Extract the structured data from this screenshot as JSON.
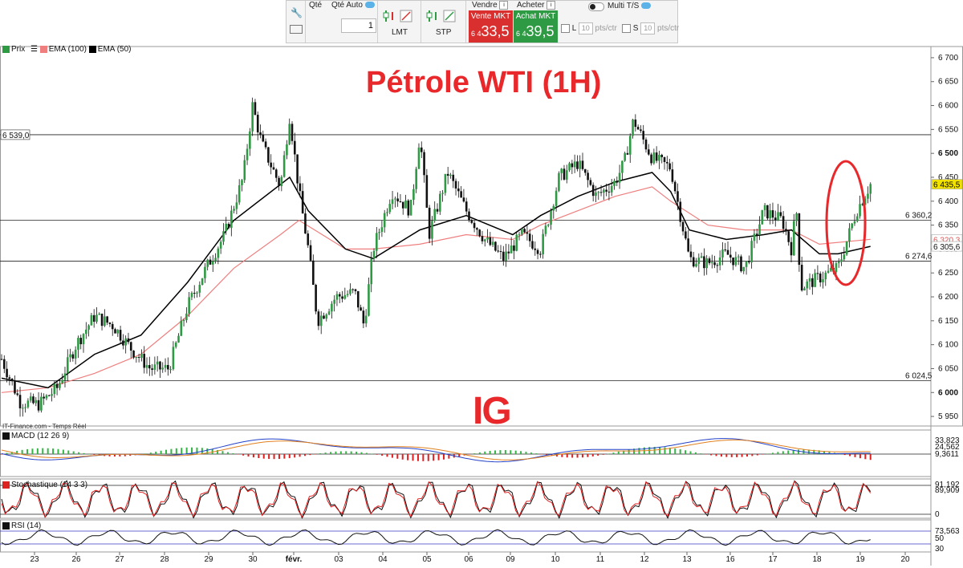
{
  "toolbar": {
    "qty_label": "Qté",
    "qty_auto_label": "Qté Auto",
    "qty_value": "1",
    "lmt_label": "LMT",
    "stp_label": "STP",
    "sell_header": "Vendre",
    "buy_header": "Acheter",
    "sell_button": "Vente MKT",
    "buy_button": "Achat MKT",
    "sell_price_prefix": "6 4",
    "sell_price_big": "33,5",
    "buy_price_prefix": "6 4",
    "buy_price_big": "39,5",
    "multi_label": "Multi T/S",
    "l_label": "L",
    "s_label": "S",
    "l_value": "10",
    "s_value": "10",
    "unit": "pts/ctr",
    "info_glyph": "i",
    "colors": {
      "sell": "#d9302f",
      "buy": "#2e9a43"
    }
  },
  "legend": {
    "price": "Prix",
    "ema100": "EMA (100)",
    "ema50": "EMA (50)",
    "macd": "MACD (12 26 9)",
    "stoch": "Stochastique (14 3 3)",
    "rsi": "RSI (14)"
  },
  "source": "IT-Finance.com - Temps Réel",
  "chart_data": {
    "type": "candlestick",
    "title": "Pétrole WTI (1H)",
    "logo": "IG",
    "ylim": [
      5930,
      6720
    ],
    "y_ticks": [
      "6 700",
      "6 650",
      "6 600",
      "6 550",
      "6 500",
      "6 450",
      "6 400",
      "6 350",
      "6 300",
      "6 250",
      "6 200",
      "6 150",
      "6 100",
      "6 050",
      "6 000",
      "5 950"
    ],
    "x_labels": [
      "23",
      "26",
      "27",
      "28",
      "29",
      "30",
      "févr.",
      "03",
      "04",
      "05",
      "06",
      "09",
      "10",
      "11",
      "12",
      "13",
      "16",
      "17",
      "18",
      "19",
      "20"
    ],
    "horizontal_levels": [
      {
        "value": 6539.0,
        "label": "6 539,0",
        "side": "left"
      },
      {
        "value": 6360.2,
        "label": "6 360,2",
        "side": "right"
      },
      {
        "value": 6274.6,
        "label": "6 274,6",
        "side": "right"
      },
      {
        "value": 6024.5,
        "label": "6 024,5",
        "side": "right"
      }
    ],
    "price_tags": [
      {
        "value": 6435.5,
        "label": "6 435,5",
        "color": "#f2e200",
        "text": "#000"
      },
      {
        "value": 6320.3,
        "label": "6 320,3",
        "color": "#ffffff",
        "text": "#e05555"
      },
      {
        "value": 6305.6,
        "label": "6 305,6",
        "color": "#ffffff",
        "text": "#111111"
      }
    ],
    "price_path": [
      [
        0,
        6070
      ],
      [
        0.02,
        5980
      ],
      [
        0.04,
        5975
      ],
      [
        0.06,
        6010
      ],
      [
        0.08,
        6100
      ],
      [
        0.1,
        6160
      ],
      [
        0.12,
        6140
      ],
      [
        0.14,
        6090
      ],
      [
        0.16,
        6050
      ],
      [
        0.18,
        6050
      ],
      [
        0.2,
        6180
      ],
      [
        0.22,
        6260
      ],
      [
        0.24,
        6330
      ],
      [
        0.26,
        6450
      ],
      [
        0.27,
        6600
      ],
      [
        0.28,
        6520
      ],
      [
        0.3,
        6430
      ],
      [
        0.31,
        6580
      ],
      [
        0.32,
        6420
      ],
      [
        0.33,
        6300
      ],
      [
        0.34,
        6150
      ],
      [
        0.36,
        6200
      ],
      [
        0.38,
        6210
      ],
      [
        0.39,
        6140
      ],
      [
        0.4,
        6300
      ],
      [
        0.42,
        6420
      ],
      [
        0.44,
        6380
      ],
      [
        0.45,
        6540
      ],
      [
        0.46,
        6330
      ],
      [
        0.48,
        6460
      ],
      [
        0.5,
        6380
      ],
      [
        0.52,
        6320
      ],
      [
        0.54,
        6280
      ],
      [
        0.56,
        6330
      ],
      [
        0.58,
        6300
      ],
      [
        0.6,
        6450
      ],
      [
        0.62,
        6480
      ],
      [
        0.64,
        6410
      ],
      [
        0.66,
        6440
      ],
      [
        0.67,
        6480
      ],
      [
        0.68,
        6570
      ],
      [
        0.7,
        6490
      ],
      [
        0.72,
        6470
      ],
      [
        0.74,
        6280
      ],
      [
        0.76,
        6270
      ],
      [
        0.78,
        6290
      ],
      [
        0.8,
        6260
      ],
      [
        0.82,
        6380
      ],
      [
        0.84,
        6360
      ],
      [
        0.85,
        6300
      ],
      [
        0.855,
        6390
      ],
      [
        0.86,
        6220
      ],
      [
        0.88,
        6240
      ],
      [
        0.9,
        6260
      ],
      [
        0.92,
        6380
      ],
      [
        0.935,
        6435.5
      ]
    ],
    "ema50_path": [
      [
        0,
        6030
      ],
      [
        0.05,
        6010
      ],
      [
        0.1,
        6080
      ],
      [
        0.15,
        6120
      ],
      [
        0.2,
        6230
      ],
      [
        0.25,
        6360
      ],
      [
        0.31,
        6450
      ],
      [
        0.33,
        6380
      ],
      [
        0.37,
        6300
      ],
      [
        0.4,
        6280
      ],
      [
        0.45,
        6340
      ],
      [
        0.5,
        6370
      ],
      [
        0.55,
        6330
      ],
      [
        0.58,
        6370
      ],
      [
        0.62,
        6410
      ],
      [
        0.66,
        6440
      ],
      [
        0.7,
        6460
      ],
      [
        0.72,
        6420
      ],
      [
        0.74,
        6340
      ],
      [
        0.78,
        6320
      ],
      [
        0.82,
        6330
      ],
      [
        0.85,
        6340
      ],
      [
        0.88,
        6290
      ],
      [
        0.9,
        6290
      ],
      [
        0.935,
        6305.6
      ]
    ],
    "ema100_path": [
      [
        0,
        6000
      ],
      [
        0.05,
        6010
      ],
      [
        0.1,
        6040
      ],
      [
        0.15,
        6080
      ],
      [
        0.2,
        6160
      ],
      [
        0.25,
        6260
      ],
      [
        0.3,
        6330
      ],
      [
        0.32,
        6360
      ],
      [
        0.37,
        6300
      ],
      [
        0.4,
        6300
      ],
      [
        0.45,
        6310
      ],
      [
        0.5,
        6330
      ],
      [
        0.55,
        6320
      ],
      [
        0.58,
        6350
      ],
      [
        0.62,
        6380
      ],
      [
        0.66,
        6410
      ],
      [
        0.7,
        6430
      ],
      [
        0.72,
        6400
      ],
      [
        0.76,
        6350
      ],
      [
        0.8,
        6340
      ],
      [
        0.85,
        6340
      ],
      [
        0.88,
        6310
      ],
      [
        0.935,
        6320.3
      ]
    ],
    "macd": {
      "ticks": [
        "33,823",
        "24,562",
        "9,3611"
      ]
    },
    "stochastic": {
      "ticks": [
        "91,192",
        "89,909",
        "0"
      ]
    },
    "rsi": {
      "ticks": [
        "73,563",
        "50",
        "30"
      ]
    }
  }
}
